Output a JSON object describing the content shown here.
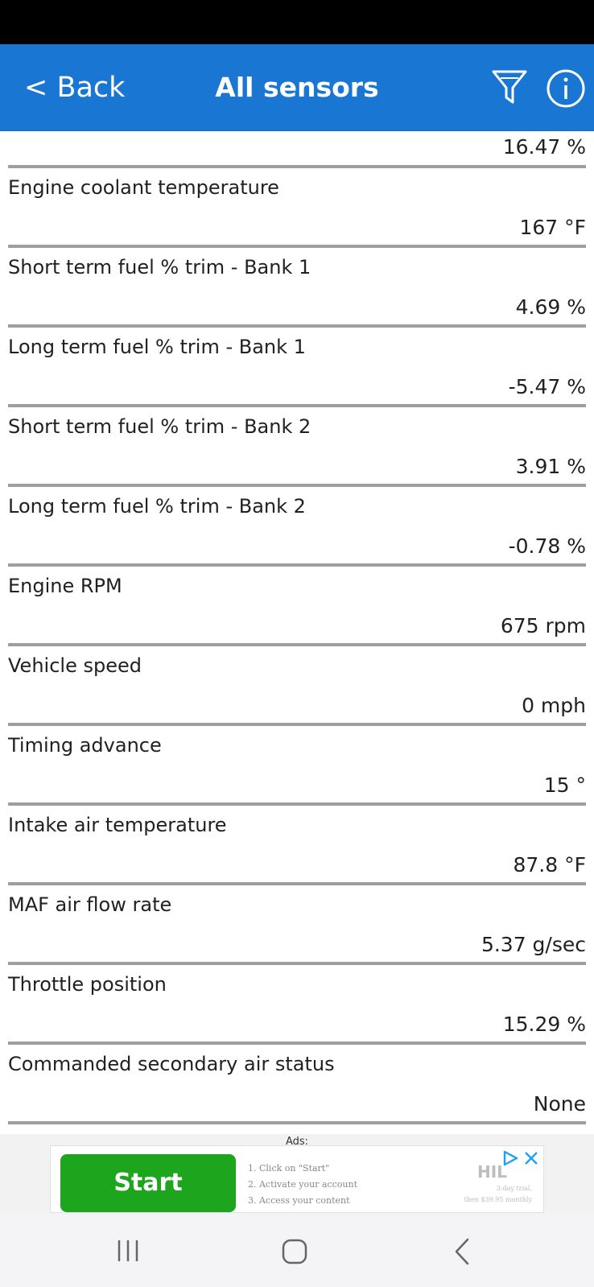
{
  "header": {
    "back_label": "< Back",
    "title": "All sensors",
    "accent_color": "#1976d2"
  },
  "icons": {
    "filter": "filter-icon",
    "info": "info-icon"
  },
  "sensors": {
    "first_value": "16.47 %",
    "items": [
      {
        "name": "Engine coolant temperature",
        "value": "167 °F"
      },
      {
        "name": "Short term fuel % trim - Bank 1",
        "value": "4.69 %"
      },
      {
        "name": "Long term fuel % trim - Bank 1",
        "value": "-5.47 %"
      },
      {
        "name": "Short term fuel % trim - Bank 2",
        "value": "3.91 %"
      },
      {
        "name": "Long term fuel % trim - Bank 2",
        "value": "-0.78 %"
      },
      {
        "name": "Engine RPM",
        "value": "675 rpm"
      },
      {
        "name": "Vehicle speed",
        "value": "0 mph"
      },
      {
        "name": "Timing advance",
        "value": "15 °"
      },
      {
        "name": "Intake air temperature",
        "value": "87.8 °F"
      },
      {
        "name": "MAF air flow rate",
        "value": "5.37 g/sec"
      },
      {
        "name": "Throttle position",
        "value": "15.29 %"
      },
      {
        "name": "Commanded secondary air status",
        "value": "None"
      }
    ]
  },
  "ad": {
    "label": "Ads:",
    "start_label": "Start",
    "steps": [
      "1. Click on \"Start\"",
      "2. Activate your account",
      "3. Access your content"
    ],
    "brand": "HIL",
    "fineprint_1": "3-day trial,",
    "fineprint_2": "then $39.95 monthly",
    "start_color": "#1ea51e"
  },
  "navbar": {
    "recents": "recents-icon",
    "home": "home-icon",
    "back": "back-icon"
  }
}
